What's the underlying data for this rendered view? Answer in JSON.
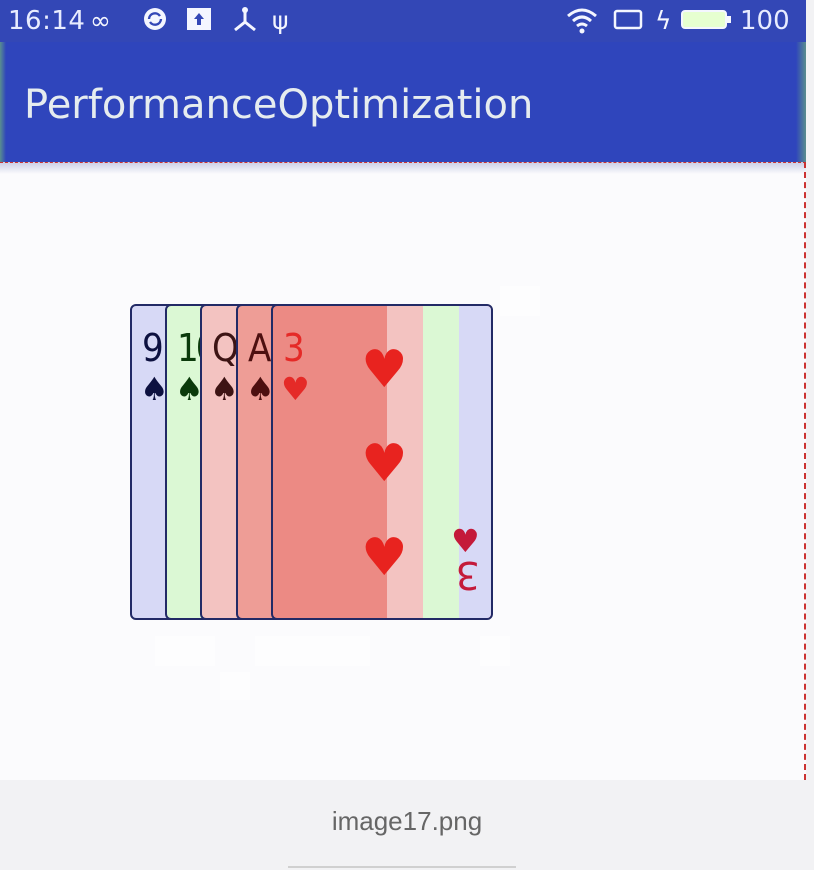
{
  "status_bar": {
    "time": "16:14",
    "icons": [
      "infinity-icon",
      "sync-icon",
      "upload-icon",
      "usb-hub-icon",
      "usb-icon",
      "wifi-icon",
      "tablet-icon",
      "charging-icon",
      "battery-icon"
    ],
    "battery": "100"
  },
  "app_bar": {
    "title": "PerformanceOptimization",
    "color": "#2f45bc"
  },
  "cards": [
    {
      "rank": "9",
      "suit": "♠",
      "overdraw_color": "#d7d9f6"
    },
    {
      "rank": "10",
      "suit": "♠",
      "overdraw_color": "#dbf8d4"
    },
    {
      "rank": "Q",
      "suit": "♠",
      "overdraw_color": "#f3c3c1"
    },
    {
      "rank": "A",
      "suit": "♠",
      "overdraw_color": "#ee9d96"
    },
    {
      "rank": "3",
      "suit": "♥",
      "overdraw_color": "#ec8a84"
    }
  ],
  "caption": "image17.png"
}
